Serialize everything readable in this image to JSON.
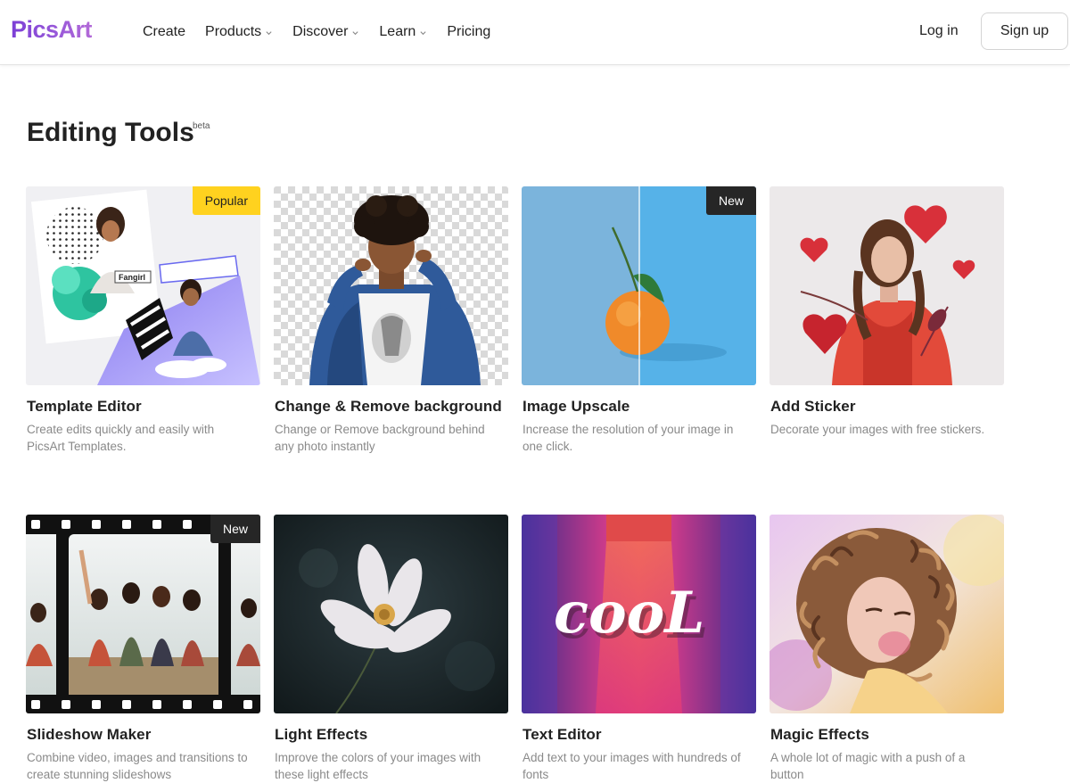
{
  "nav": {
    "logo": "PicsArt",
    "items": [
      {
        "label": "Create",
        "dropdown": false
      },
      {
        "label": "Products",
        "dropdown": true
      },
      {
        "label": "Discover",
        "dropdown": true
      },
      {
        "label": "Learn",
        "dropdown": true
      },
      {
        "label": "Pricing",
        "dropdown": false
      }
    ],
    "login": "Log in",
    "signup": "Sign up"
  },
  "section": {
    "title": "Editing Tools",
    "tag": "beta"
  },
  "colors": {
    "brand": "#7c3fd6",
    "badge_popular": "#ffd21f",
    "badge_new": "#262626"
  },
  "tools": [
    {
      "title": "Template Editor",
      "desc": "Create edits quickly and easily with PicsArt Templates.",
      "badge": "Popular"
    },
    {
      "title": "Change & Remove background",
      "desc": "Change or Remove background behind any photo instantly",
      "badge": ""
    },
    {
      "title": "Image Upscale",
      "desc": "Increase the resolution of your image in one click.",
      "badge": "New"
    },
    {
      "title": "Add Sticker",
      "desc": "Decorate your images with free stickers.",
      "badge": ""
    },
    {
      "title": "Slideshow Maker",
      "desc": "Combine video, images and transitions to create stunning slideshows",
      "badge": "New"
    },
    {
      "title": "Light Effects",
      "desc": "Improve the colors of your images with these light effects",
      "badge": ""
    },
    {
      "title": "Text Editor",
      "desc": "Add text to your images with hundreds of fonts",
      "badge": ""
    },
    {
      "title": "Magic Effects",
      "desc": "A whole lot of magic with a push of a button",
      "badge": ""
    }
  ],
  "thumb_texts": {
    "fangirl": "Fangirl",
    "cool": "cooL"
  }
}
